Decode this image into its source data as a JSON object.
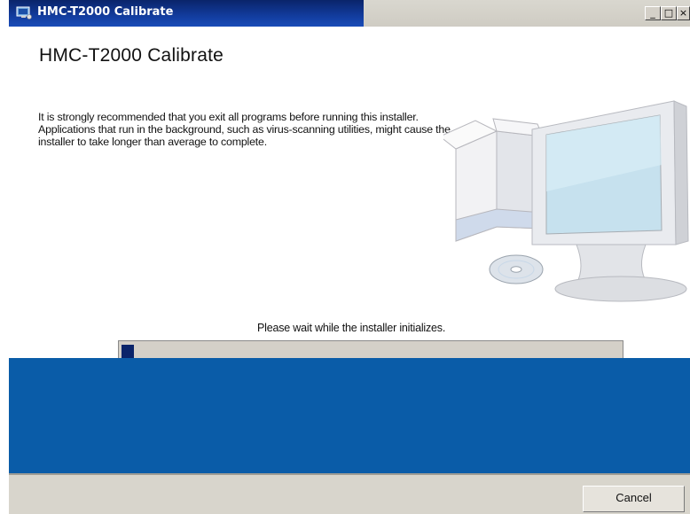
{
  "window": {
    "title": "HMC-T2000 Calibrate",
    "icon": "installer-icon",
    "controls": {
      "minimize": "_",
      "maximize": "□",
      "close": "×"
    }
  },
  "main": {
    "heading": "HMC-T2000 Calibrate",
    "description": "It is strongly recommended that you exit all programs before running this installer. Applications that run in the background, such as virus-scanning utilities, might cause the installer to take longer than average to complete.",
    "illustration": "computer-box-cd-illustration"
  },
  "progress": {
    "status": "Please wait while the installer initializes.",
    "fraction": 0.025
  },
  "footer": {
    "cancel_label": "Cancel"
  },
  "colors": {
    "titlebar": "#0a246a",
    "band": "#0a5ca8",
    "progress_fill": "#0a246a",
    "footer_bg": "#d8d5cc"
  }
}
